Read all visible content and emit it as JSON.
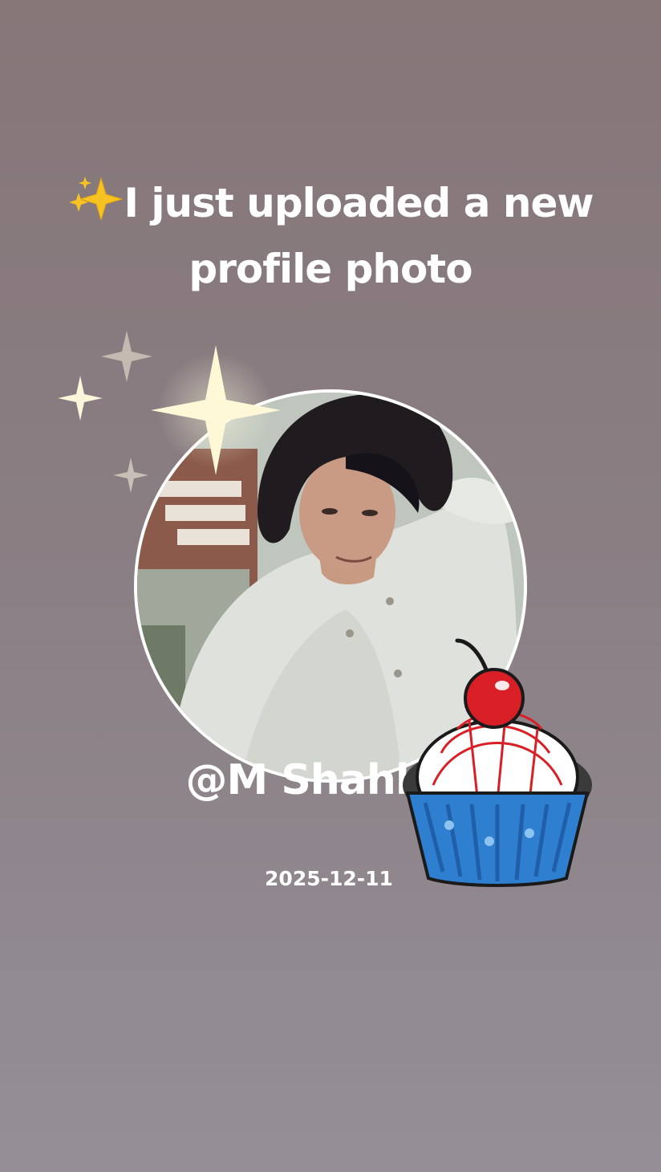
{
  "post": {
    "headline_line1": "I just uploaded a new",
    "headline_line2": "profile photo",
    "leading_emoji": "sparkles-icon",
    "username": "@M Shahbaz",
    "date": "2025-12-11"
  },
  "decorations": {
    "sparkles": [
      "sparkle-large-icon",
      "sparkle-small-icon",
      "sparkle-faded-icon",
      "sparkle-tiny-icon"
    ],
    "sticker": "cupcake-cherry-icon"
  },
  "colors": {
    "background_top": "#857678",
    "background_bottom": "#948f96",
    "text": "#ffffff",
    "cupcake_liner": "#2f7fd0",
    "cherry": "#d81f26"
  }
}
